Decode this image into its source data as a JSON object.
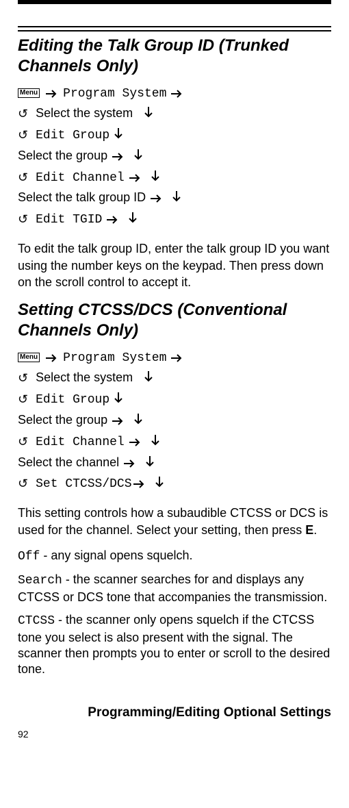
{
  "menu_label": "Menu",
  "section1": {
    "title": "Editing the Talk Group ID (Trunked Channels Only)",
    "nav": {
      "l1a": "Program System",
      "l2": "Select the system",
      "l3": "Edit Group",
      "l4": "Select the group",
      "l5": "Edit Channel",
      "l6": "Select the talk group ID",
      "l7": "Edit TGID"
    },
    "body": "To edit the talk group ID, enter the talk group ID you want using the number keys on the keypad. Then press down on the scroll control to accept it."
  },
  "section2": {
    "title": "Setting CTCSS/DCS (Conventional Channels Only)",
    "nav": {
      "l1a": "Program System",
      "l2": "Select the system",
      "l3": "Edit Group",
      "l4": "Select the group",
      "l5": "Edit Channel",
      "l6": "Select the channel",
      "l7": "Set CTCSS/DCS"
    },
    "body_a": "This setting controls how a subaudible CTCSS or DCS is used for the channel. Select your setting, then press ",
    "body_b": "E",
    "body_c": ".",
    "defs": {
      "off_k": "Off",
      "off_t": " - any signal opens squelch.",
      "search_k": "Search",
      "search_t": " - the scanner searches for and displays any CTCSS or DCS tone that accompanies the transmission.",
      "ctcss_k": "CTCSS",
      "ctcss_t": " - the scanner only opens squelch if the CTCSS tone you select is also present with the signal. The scanner then prompts you to enter or scroll to the desired tone."
    }
  },
  "footer": "Programming/Editing Optional Settings",
  "page_number": "92"
}
